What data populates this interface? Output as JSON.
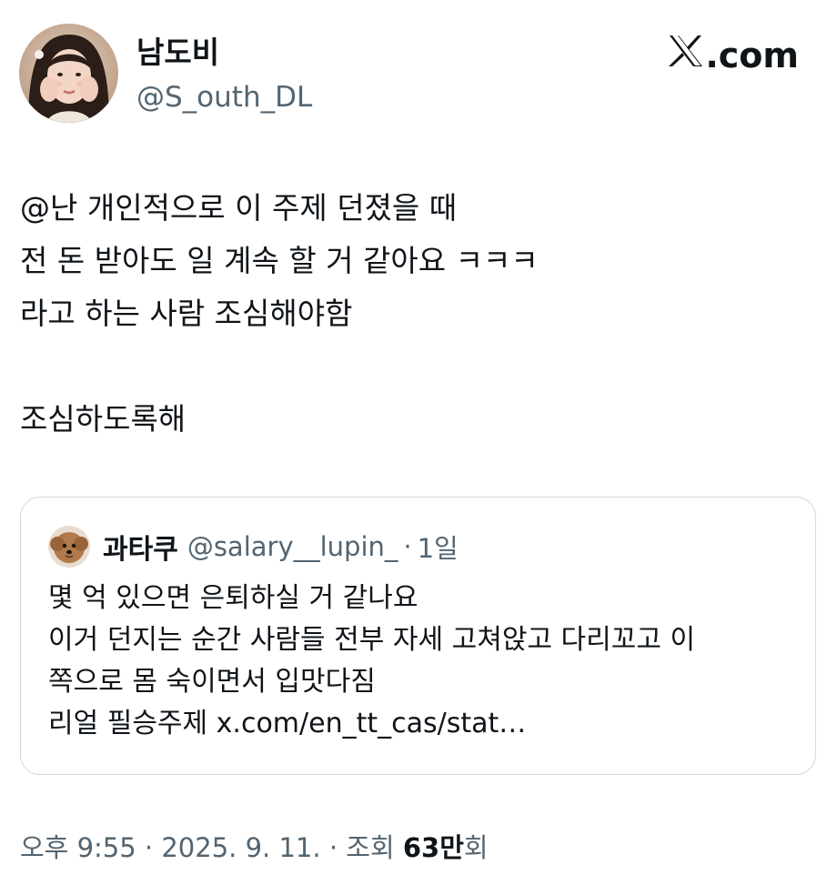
{
  "author": {
    "display_name": "남도비",
    "handle": "@S_outh_DL"
  },
  "brand": {
    "label": ".com"
  },
  "tweet": {
    "lines": [
      "@난 개인적으로 이 주제 던졌을 때",
      "전 돈 받아도 일 계속 할 거 같아요 ㅋㅋㅋ",
      "라고 하는 사람 조심해야함",
      "조심하도록해"
    ]
  },
  "quote": {
    "display_name": "과타쿠",
    "handle": "@salary__lupin_",
    "separator": "·",
    "age": "1일",
    "lines": [
      "몇 억 있으면 은퇴하실 거 같나요",
      "이거 던지는 순간 사람들 전부 자세 고쳐앉고 다리꼬고 이",
      "쪽으로 몸 숙이면서 입맛다짐",
      "리얼 필승주제 x.com/en_tt_cas/stat…"
    ]
  },
  "meta": {
    "time": "오후 9:55",
    "sep1": " · ",
    "date": "2025. 9. 11.",
    "sep2": " · ",
    "views_label": "조회 ",
    "views_count": "63만",
    "views_suffix": "회"
  },
  "colors": {
    "text_primary": "#0f1419",
    "text_secondary": "#536471",
    "border": "#cfd9de",
    "background": "#ffffff"
  }
}
